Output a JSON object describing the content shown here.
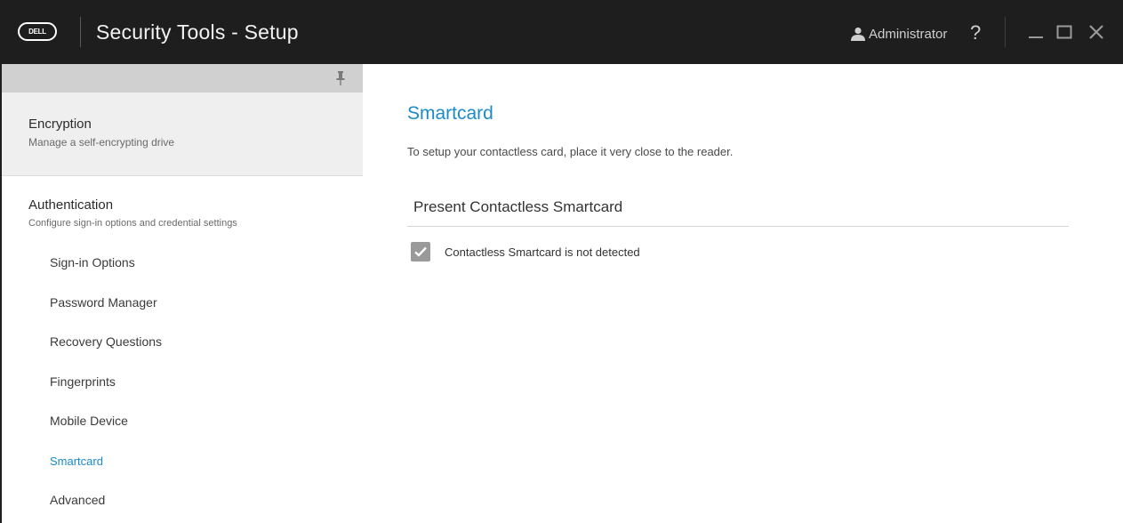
{
  "titlebar": {
    "logo_text": "DELL",
    "app_title": "Security Tools - Setup",
    "user_name": "Administrator",
    "help_glyph": "?",
    "icons": [
      "user-icon",
      "help-icon",
      "minimize-icon",
      "maximize-icon",
      "close-icon"
    ]
  },
  "sidebar": {
    "pin_icon": "pin-icon",
    "sections": [
      {
        "title": "Encryption",
        "description": "Manage a self-encrypting drive"
      },
      {
        "title": "Authentication",
        "description": "Configure sign-in options and credential settings",
        "items": [
          {
            "label": "Sign-in Options"
          },
          {
            "label": "Password Manager"
          },
          {
            "label": "Recovery Questions"
          },
          {
            "label": "Fingerprints"
          },
          {
            "label": "Mobile Device"
          },
          {
            "label": "Smartcard",
            "active": true
          },
          {
            "label": "Advanced"
          }
        ]
      }
    ]
  },
  "main": {
    "title": "Smartcard",
    "instructions": "To setup your contactless card, place it very close to the reader.",
    "section_title": "Present Contactless Smartcard",
    "status_icon": "check-icon",
    "status_text": "Contactless Smartcard is not detected"
  },
  "colors": {
    "titlebar_bg": "#1e1e1e",
    "accent": "#1a8bc8",
    "sidebar_header": "#d0d0d0",
    "selected_section_bg": "#efefef",
    "status_icon_bg": "#9a9a9a"
  }
}
